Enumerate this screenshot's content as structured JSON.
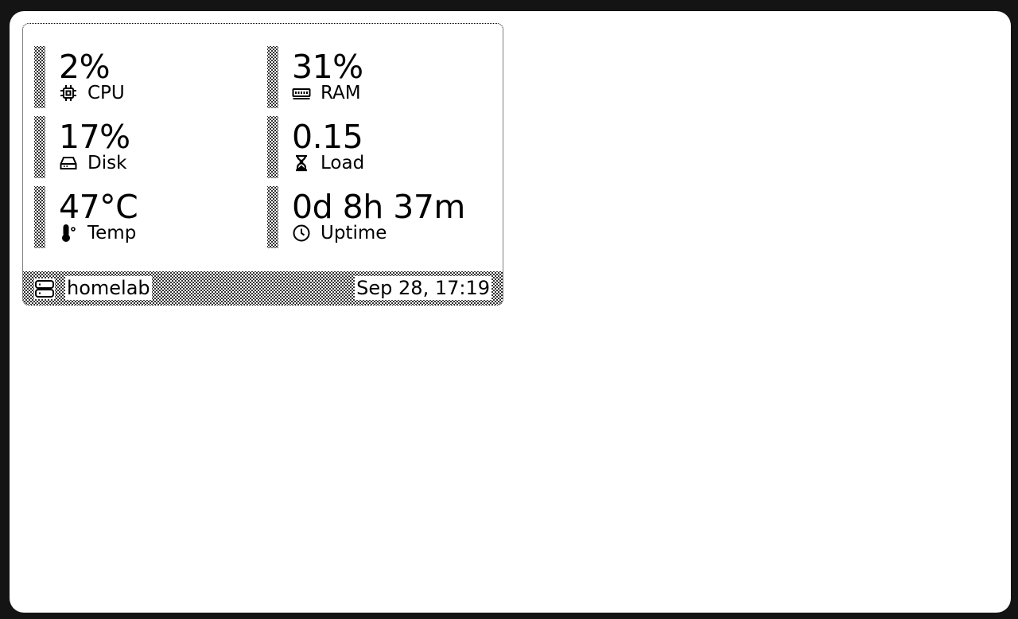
{
  "stats": {
    "cpu": {
      "value": "2%",
      "label": "CPU",
      "icon": "cpu-icon"
    },
    "ram": {
      "value": "31%",
      "label": "RAM",
      "icon": "memory-icon"
    },
    "disk": {
      "value": "17%",
      "label": "Disk",
      "icon": "disk-icon"
    },
    "load": {
      "value": "0.15",
      "label": "Load",
      "icon": "hourglass-icon"
    },
    "temp": {
      "value": "47°C",
      "label": "Temp",
      "icon": "thermometer-icon"
    },
    "uptime": {
      "value": "0d 8h 37m",
      "label": "Uptime",
      "icon": "clock-icon"
    }
  },
  "footer": {
    "hostname": "homelab",
    "host_icon": "server-icon",
    "datetime": "Sep 28, 17:19"
  },
  "colors": {
    "background": "#141414",
    "screen": "#ffffff",
    "ink": "#000000"
  }
}
